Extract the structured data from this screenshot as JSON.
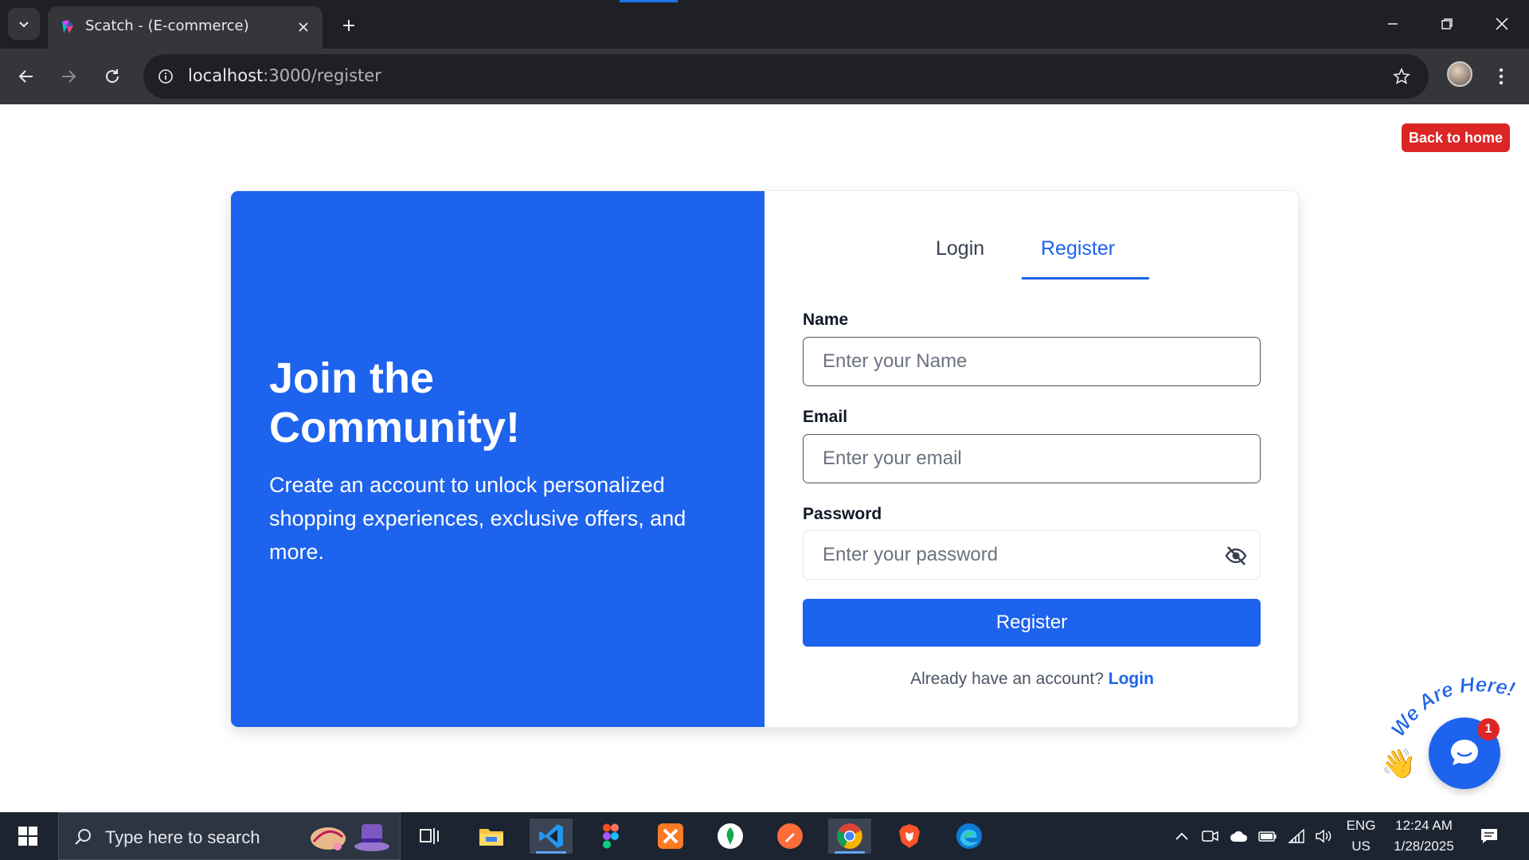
{
  "browser": {
    "tab_title": "Scatch - (E-commerce)",
    "url_host": "localhost",
    "url_rest": ":3000/register"
  },
  "page": {
    "back_home_label": "Back to home",
    "hero": {
      "title": "Join the Community!",
      "subtitle": "Create an account to unlock personalized shopping experiences, exclusive offers, and more."
    },
    "tabs": {
      "login": "Login",
      "register": "Register",
      "active": "register"
    },
    "form": {
      "name_label": "Name",
      "name_placeholder": "Enter your Name",
      "email_label": "Email",
      "email_placeholder": "Enter your email",
      "password_label": "Password",
      "password_placeholder": "Enter your password",
      "submit_label": "Register",
      "have_account_text": "Already have an account?",
      "login_link": "Login"
    }
  },
  "chat_widget": {
    "caption": "We Are Here!",
    "badge_count": "1"
  },
  "taskbar": {
    "search_placeholder": "Type here to search",
    "apps": [
      "task-view",
      "file-explorer",
      "vscode",
      "figma",
      "xampp",
      "mongodb-compass",
      "postman",
      "chrome",
      "brave",
      "edge"
    ],
    "active_app": "chrome",
    "language_top": "ENG",
    "language_bottom": "US",
    "time": "12:24 AM",
    "date": "1/28/2025"
  },
  "colors": {
    "primary": "#1d63ed",
    "danger": "#dc2626",
    "chrome_dark": "#1f2024",
    "chrome_mid": "#35363a",
    "taskbar": "#1c2431"
  }
}
